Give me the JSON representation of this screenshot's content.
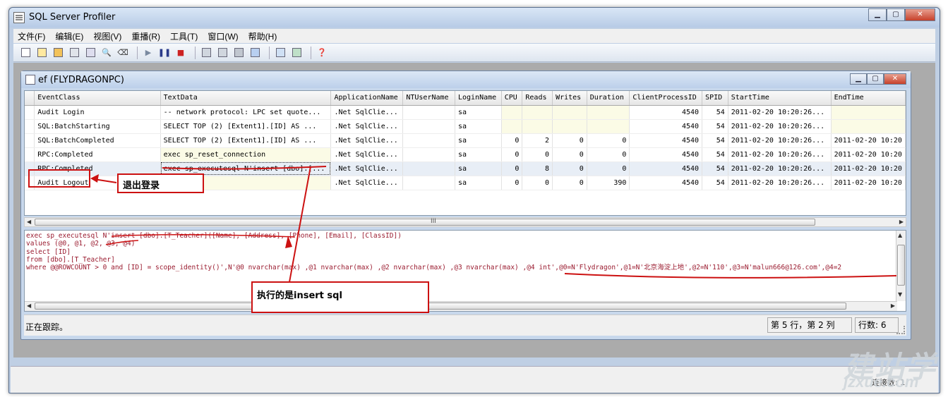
{
  "app": {
    "title": "SQL Server Profiler"
  },
  "menu": [
    "文件(F)",
    "编辑(E)",
    "视图(V)",
    "重播(R)",
    "工具(T)",
    "窗口(W)",
    "帮助(H)"
  ],
  "toolbar_icons": [
    "new-trace-icon",
    "new-template-icon",
    "open-icon",
    "save-icon",
    "properties-icon",
    "find-icon",
    "clear-icon",
    "run-icon",
    "pause-icon",
    "stop-icon",
    "step-icon",
    "run-to-cursor-icon",
    "bookmark-icon",
    "auto-scroll-icon",
    "activity-monitor-icon",
    "tuning-advisor-icon",
    "help-icon"
  ],
  "trace_window": {
    "title": "ef (FLYDRAGONPC)"
  },
  "columns": [
    "EventClass",
    "TextData",
    "ApplicationName",
    "NTUserName",
    "LoginName",
    "CPU",
    "Reads",
    "Writes",
    "Duration",
    "ClientProcessID",
    "SPID",
    "StartTime",
    "EndTime"
  ],
  "rows": [
    [
      "Audit Login",
      "-- network protocol: LPC  set quote...",
      ".Net SqlClie...",
      "",
      "sa",
      "",
      "",
      "",
      "",
      "4540",
      "54",
      "2011-02-20 10:20:26...",
      ""
    ],
    [
      "SQL:BatchStarting",
      "SELECT TOP (2)    [Extent1].[ID] AS ...",
      ".Net SqlClie...",
      "",
      "sa",
      "",
      "",
      "",
      "",
      "4540",
      "54",
      "2011-02-20 10:20:26...",
      ""
    ],
    [
      "SQL:BatchCompleted",
      "SELECT TOP (2)    [Extent1].[ID] AS ...",
      ".Net SqlClie...",
      "",
      "sa",
      "0",
      "2",
      "0",
      "0",
      "4540",
      "54",
      "2011-02-20 10:20:26...",
      "2011-02-20 10:20"
    ],
    [
      "RPC:Completed",
      "exec sp_reset_connection",
      ".Net SqlClie...",
      "",
      "sa",
      "0",
      "0",
      "0",
      "0",
      "4540",
      "54",
      "2011-02-20 10:20:26...",
      "2011-02-20 10:20"
    ],
    [
      "RPC:Completed",
      "exec sp_executesql N'insert [dbo].[...",
      ".Net SqlClie...",
      "",
      "sa",
      "0",
      "8",
      "0",
      "0",
      "4540",
      "54",
      "2011-02-20 10:20:26...",
      "2011-02-20 10:20"
    ],
    [
      "Audit Logout",
      "",
      ".Net SqlClie...",
      "",
      "sa",
      "0",
      "0",
      "0",
      "390",
      "4540",
      "54",
      "2011-02-20 10:20:26...",
      "2011-02-20 10:20"
    ]
  ],
  "sql_text": {
    "line1": "exec sp_executesql N'insert [dbo].[T_Teacher]([Name], [Address], [Phone], [Email], [ClassID])",
    "line2": "values (@0, @1, @2, @3, @4)",
    "line3": "select [ID]",
    "line4": "from [dbo].[T_Teacher]",
    "line5": "where @@ROWCOUNT > 0 and [ID] = scope_identity()',N'@0 nvarchar(max) ,@1 nvarchar(max) ,@2 nvarchar(max) ,@3 nvarchar(max) ,@4 int',@0=N'Flydragon',@1=N'北京海淀上地',@2=N'110',@3=N'malun666@126.com',@4=2"
  },
  "status": {
    "left": "正在跟踪。",
    "position": "第 5 行，第 2 列",
    "rows": "行数: 6",
    "connection": "连接数: 1"
  },
  "annotations": {
    "logout_label": "退出登录",
    "insert_label": "执行的是insert sql"
  },
  "watermark": {
    "line1": "建站学",
    "line2": "jzxue.com"
  },
  "colors": {
    "annotation_red": "#cc1111",
    "sql_text": "#9a1b2f",
    "highlight_cell": "#fbfbe6"
  }
}
